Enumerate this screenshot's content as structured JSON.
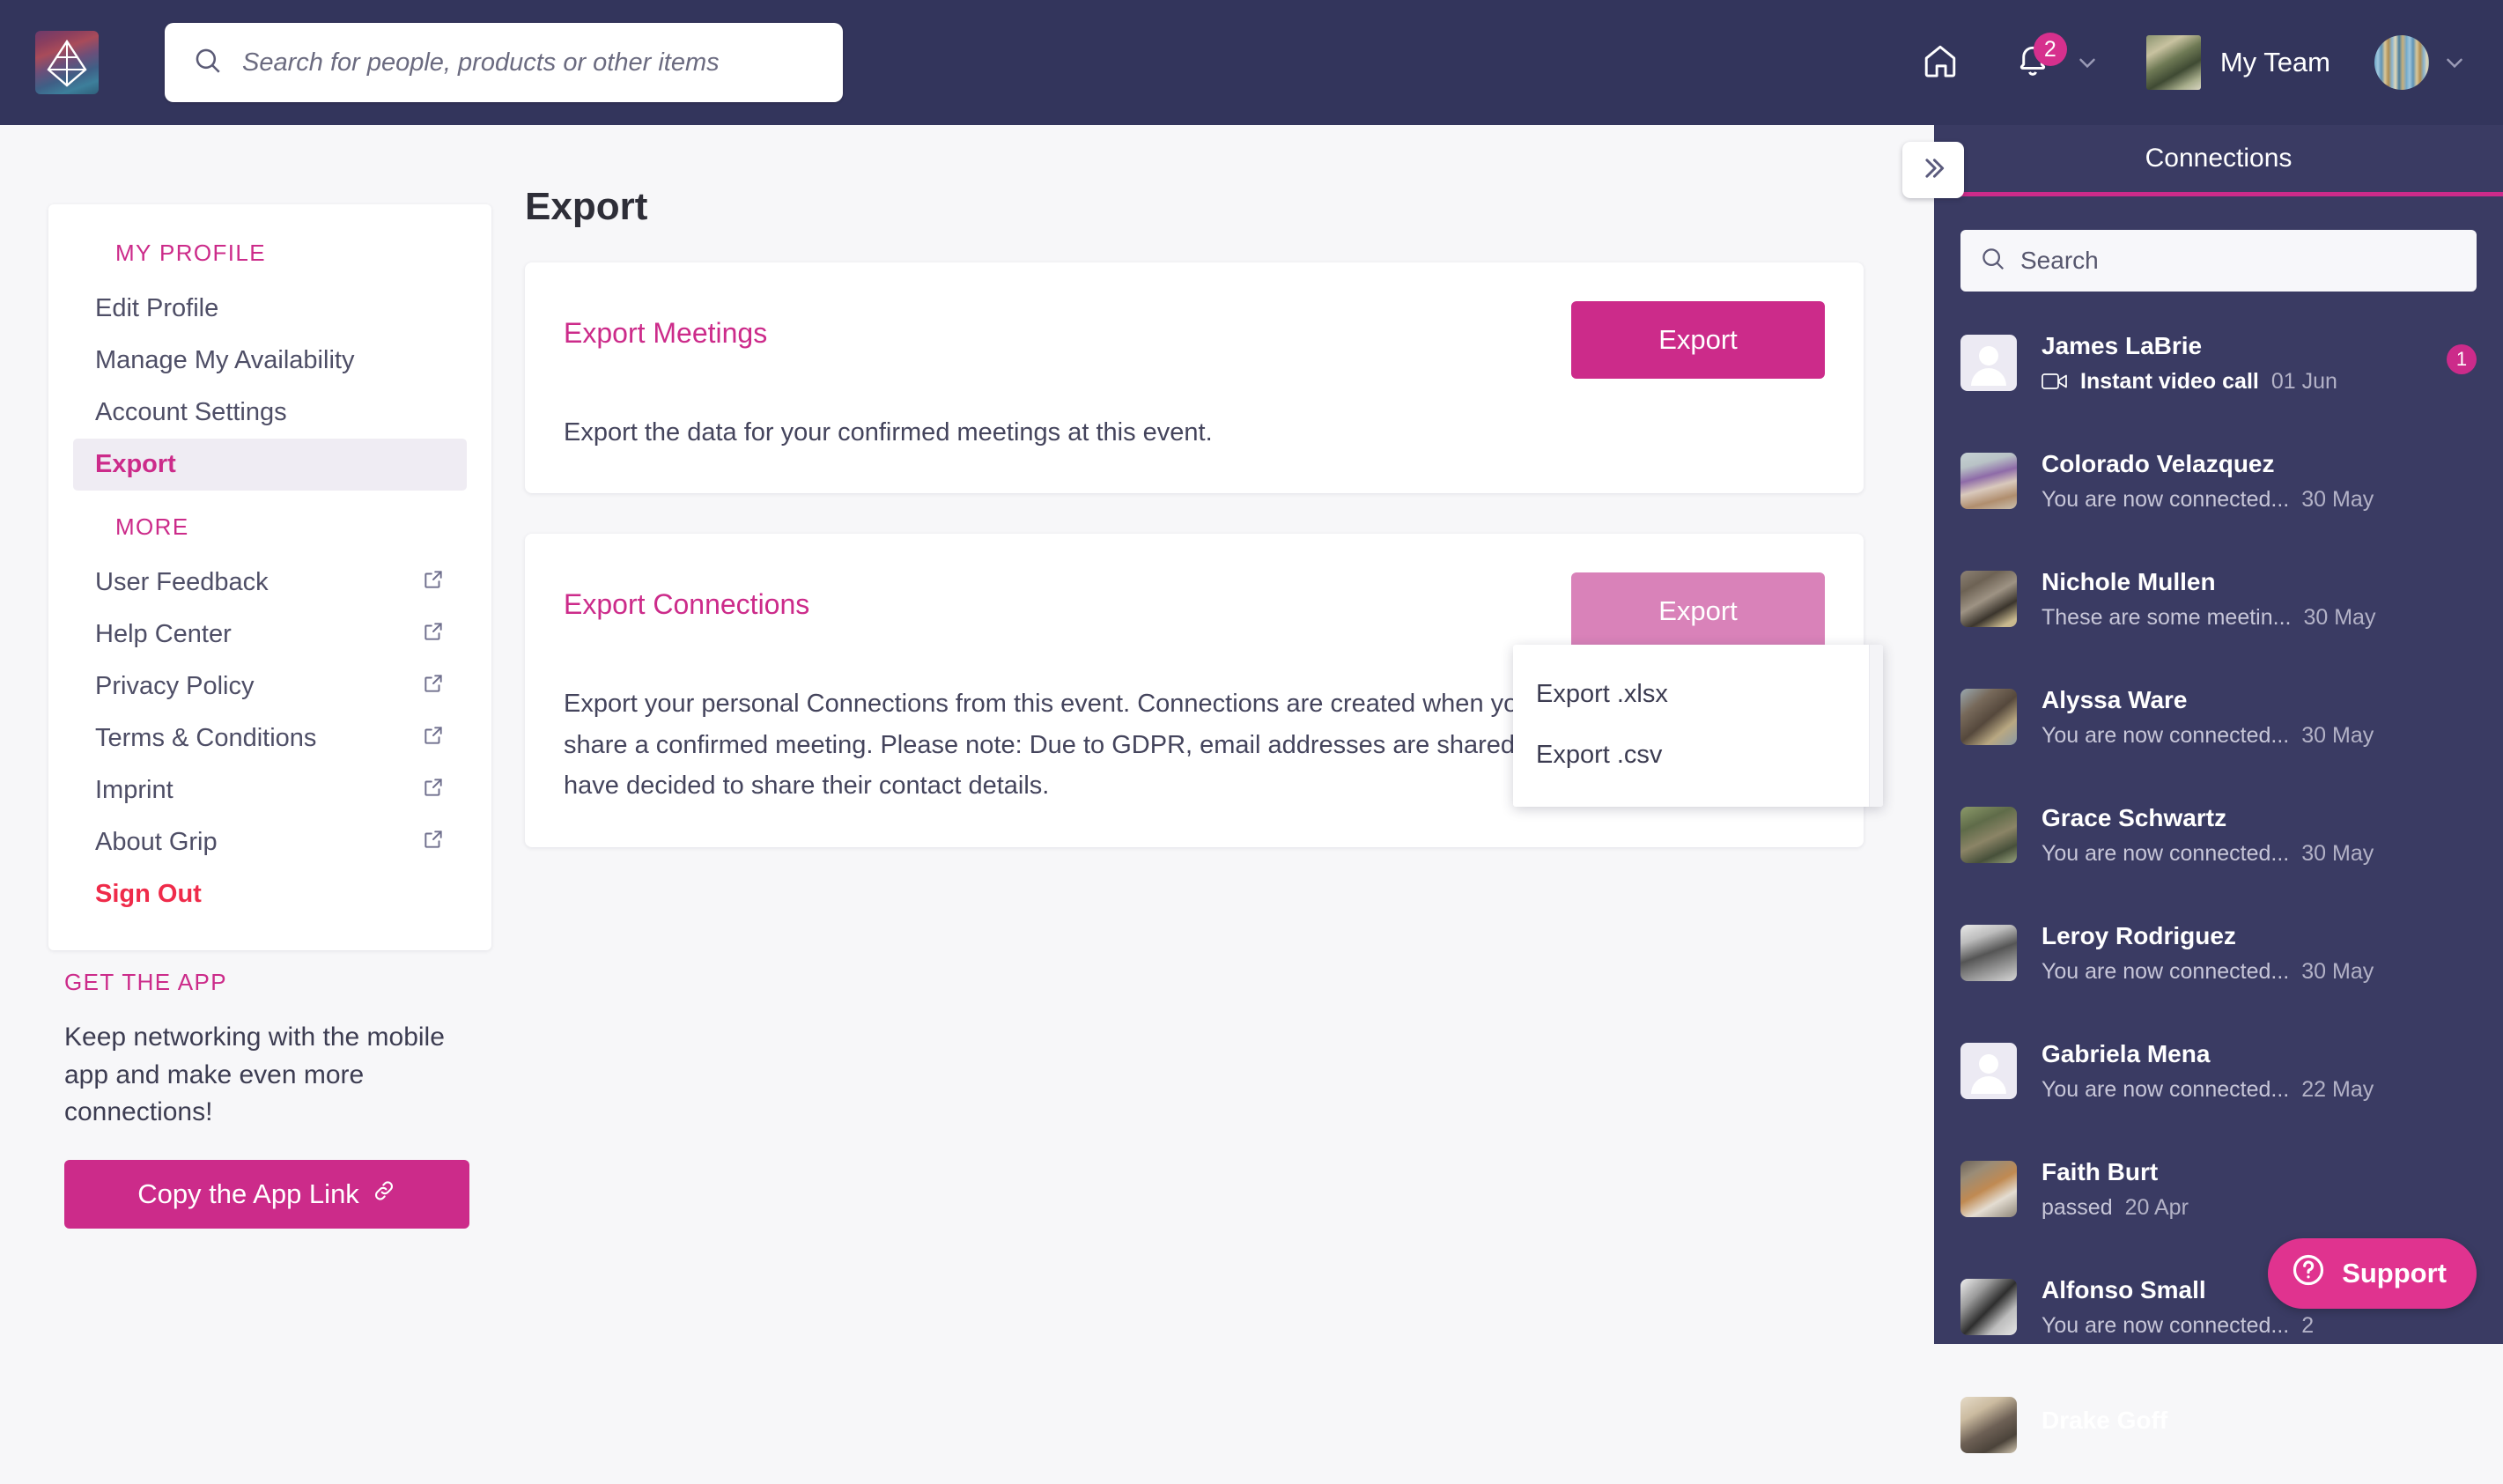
{
  "header": {
    "logo_icon": "grip-diamond-logo",
    "search": {
      "placeholder": "Search for people, products or other items",
      "value": "",
      "icon": "search-icon"
    },
    "home_icon": "home-icon",
    "bell_icon": "bell-icon",
    "notification_count": "2",
    "team_label": "My Team",
    "team_chevron_icon": "chevron-down-icon",
    "user_chevron_icon": "chevron-down-icon"
  },
  "sidebar": {
    "profile_section_title": "MY PROFILE",
    "profile_items": [
      {
        "label": "Edit Profile",
        "external": false,
        "active": false
      },
      {
        "label": "Manage My Availability",
        "external": false,
        "active": false
      },
      {
        "label": "Account Settings",
        "external": false,
        "active": false
      },
      {
        "label": "Export",
        "external": false,
        "active": true
      }
    ],
    "more_section_title": "MORE",
    "more_items": [
      {
        "label": "User Feedback",
        "external": true
      },
      {
        "label": "Help Center",
        "external": true
      },
      {
        "label": "Privacy Policy",
        "external": true
      },
      {
        "label": "Terms & Conditions",
        "external": true
      },
      {
        "label": "Imprint",
        "external": true
      },
      {
        "label": "About Grip",
        "external": true
      }
    ],
    "sign_out_label": "Sign Out",
    "get_the_app": {
      "title": "GET THE APP",
      "text": "Keep networking with the mobile app and make even more connections!",
      "button_label": "Copy the App Link",
      "button_icon": "link-icon"
    }
  },
  "main": {
    "page_title": "Export",
    "cards": [
      {
        "title": "Export Meetings",
        "description": "Export the data for your confirmed meetings at this event.",
        "button_label": "Export",
        "hovered": false
      },
      {
        "title": "Export Connections",
        "description": "Export your personal Connections from this event. Connections are created when you show mutual interest or share a confirmed meeting. Please note: Due to GDPR, email addresses are shared only for the users who have decided to share their contact details.",
        "button_label": "Export",
        "hovered": true
      }
    ],
    "dropdown": {
      "open": true,
      "items": [
        "Export .xlsx",
        "Export .csv"
      ]
    }
  },
  "right_panel": {
    "title": "Connections",
    "collapse_icon": "double-chevron-right-icon",
    "search": {
      "placeholder": "Search",
      "value": "",
      "icon": "search-icon"
    },
    "connections": [
      {
        "name": "James LaBrie",
        "message": "Instant video call",
        "date": "01 Jun",
        "badge": "1",
        "unread": true,
        "has_video_icon": true,
        "avatar": "placeholder"
      },
      {
        "name": "Colorado Velazquez",
        "message": "You are now connected...",
        "date": "30 May",
        "badge": "",
        "unread": false,
        "has_video_icon": false,
        "avatar": "photo-kitchen"
      },
      {
        "name": "Nichole Mullen",
        "message": "These are some meetin...",
        "date": "30 May",
        "badge": "",
        "unread": false,
        "has_video_icon": false,
        "avatar": "photo-cat-lying"
      },
      {
        "name": "Alyssa Ware",
        "message": "You are now connected...",
        "date": "30 May",
        "badge": "",
        "unread": false,
        "has_video_icon": false,
        "avatar": "photo-cat-closeup"
      },
      {
        "name": "Grace Schwartz",
        "message": "You are now connected...",
        "date": "30 May",
        "badge": "",
        "unread": false,
        "has_video_icon": false,
        "avatar": "photo-cat-tree"
      },
      {
        "name": "Leroy Rodriguez",
        "message": "You are now connected...",
        "date": "30 May",
        "badge": "",
        "unread": false,
        "has_video_icon": false,
        "avatar": "photo-cat-bw"
      },
      {
        "name": "Gabriela Mena",
        "message": "You are now connected...",
        "date": "22 May",
        "badge": "",
        "unread": false,
        "has_video_icon": false,
        "avatar": "placeholder"
      },
      {
        "name": "Faith Burt",
        "message": "passed",
        "date": "20 Apr",
        "badge": "",
        "unread": false,
        "has_video_icon": false,
        "avatar": "photo-puppy"
      },
      {
        "name": "Alfonso Small",
        "message": "You are now connected...",
        "date": "2",
        "badge": "",
        "unread": false,
        "has_video_icon": false,
        "avatar": "photo-cat-cage"
      },
      {
        "name": "Drake Goff",
        "message": "",
        "date": "",
        "badge": "",
        "unread": false,
        "has_video_icon": false,
        "avatar": "photo-kittens"
      }
    ],
    "support_label": "Support",
    "support_icon": "question-circle-icon"
  },
  "colors": {
    "navy": "#33355c",
    "panel_navy": "#3a3b63",
    "accent_pink": "#cc2b8a",
    "accent_pink_light": "#d982b9",
    "support_pink": "#e0338f",
    "signout_red": "#ef2b4a",
    "page_bg": "#f7f7f9"
  }
}
